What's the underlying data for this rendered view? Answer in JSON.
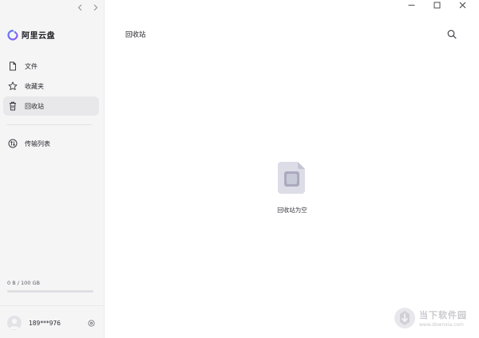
{
  "app": {
    "name": "阿里云盘"
  },
  "sidebar": {
    "items": [
      {
        "label": "文件",
        "icon": "file-icon",
        "active": false
      },
      {
        "label": "收藏夹",
        "icon": "star-icon",
        "active": false
      },
      {
        "label": "回收站",
        "icon": "trash-icon",
        "active": true
      }
    ],
    "transfer": {
      "label": "传输列表",
      "icon": "transfer-icon"
    },
    "storage": {
      "text": "0 B / 100 GB",
      "used_fraction": 0
    },
    "user": {
      "name": "189***976"
    }
  },
  "main": {
    "title": "回收站",
    "empty_text": "回收站为空"
  },
  "watermark": {
    "title": "当下软件园",
    "url": "www.downxia.com"
  },
  "colors": {
    "accent": "#6b6cf0",
    "sidebar_bg": "#f5f5f6",
    "active_bg": "#e8e8ea"
  }
}
